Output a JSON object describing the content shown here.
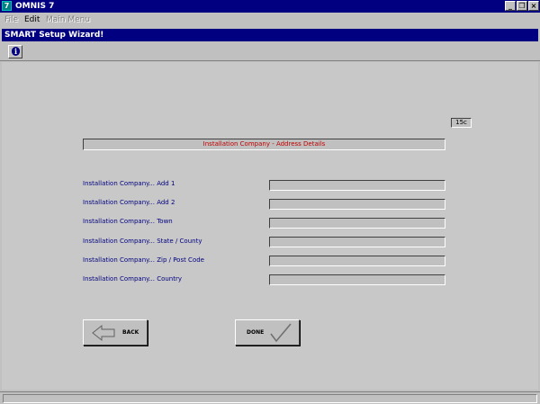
{
  "app": {
    "title": "OMNIS 7",
    "icon": "omnis-app-icon",
    "window_controls": {
      "minimize": "_",
      "restore": "❐",
      "close": "×"
    }
  },
  "menubar": {
    "items": [
      {
        "label": "File",
        "enabled": false
      },
      {
        "label": "Edit",
        "enabled": true
      },
      {
        "label": "Main Menu",
        "enabled": false
      }
    ]
  },
  "wizard": {
    "title": "SMART Setup Wizard!",
    "toolbar": {
      "info_icon": "info-icon",
      "info_glyph": "i"
    },
    "page_indicator": "15c",
    "section_header": "Installation Company - Address Details",
    "fields": [
      {
        "label": "Installation Company... Add 1",
        "value": ""
      },
      {
        "label": "Installation Company... Add 2",
        "value": ""
      },
      {
        "label": "Installation Company... Town",
        "value": ""
      },
      {
        "label": "Installation Company... State / County",
        "value": ""
      },
      {
        "label": "Installation Company... Zip / Post Code",
        "value": ""
      },
      {
        "label": "Installation Company... Country",
        "value": ""
      }
    ],
    "buttons": {
      "back_label": "BACK",
      "back_icon": "back-arrow-icon",
      "done_label": "DONE",
      "done_icon": "checkmark-icon"
    }
  },
  "colors": {
    "titlebar": "#000080",
    "window_bg": "#c0c0c0",
    "label_text": "#000080",
    "header_text": "#c00000"
  }
}
